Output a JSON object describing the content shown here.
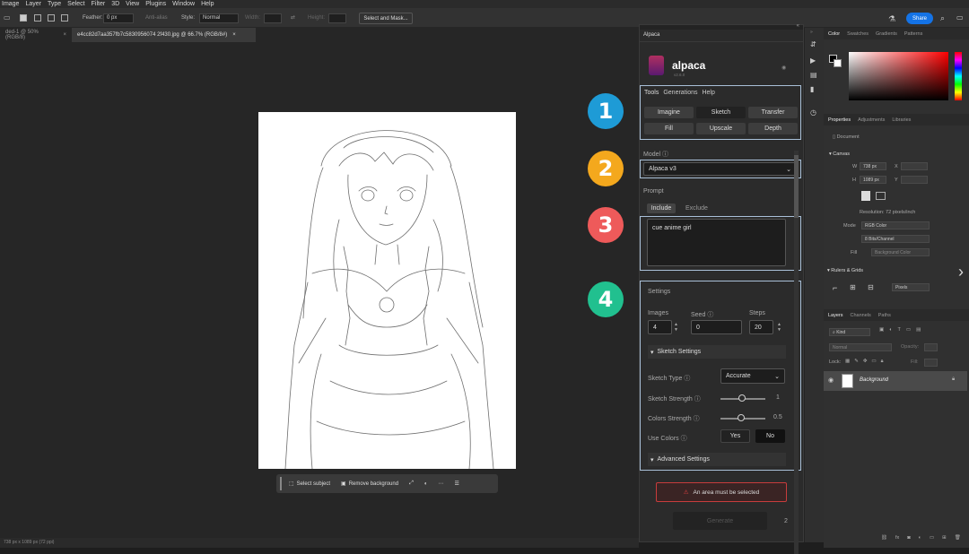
{
  "menu": [
    "Image",
    "Layer",
    "Type",
    "Select",
    "Filter",
    "3D",
    "View",
    "Plugins",
    "Window",
    "Help"
  ],
  "options": {
    "feather_label": "Feather:",
    "feather_value": "0 px",
    "anti_alias": "Anti-alias",
    "style_label": "Style:",
    "style_value": "Normal",
    "width_label": "Width:",
    "height_label": "Height:",
    "select_mask": "Select and Mask...",
    "share": "Share"
  },
  "tabs": [
    "ded-1 @ 50% (RGB/8)",
    "e4cc82d7aa357fb7c5830956074 2f430.jpg @ 66.7% (RGB/8#)"
  ],
  "context_bar": {
    "select_subject": "Select subject",
    "remove_background": "Remove background"
  },
  "status": "738 px x 1089 px (72 ppi)",
  "alpaca": {
    "panel_tab": "Alpaca",
    "title": "alpaca",
    "version": "v2.6.0",
    "menu": [
      "Tools",
      "Generations",
      "Help"
    ],
    "tools": [
      "Imagine",
      "Sketch",
      "Transfer",
      "Fill",
      "Upscale",
      "Depth"
    ],
    "model_label": "Model",
    "model_value": "Alpaca v3",
    "prompt_label": "Prompt",
    "include": "Include",
    "exclude": "Exclude",
    "prompt_text": "cue anime girl",
    "settings_label": "Settings",
    "images_label": "Images",
    "images_value": "4",
    "seed_label": "Seed",
    "seed_value": "0",
    "steps_label": "Steps",
    "steps_value": "20",
    "sketch_settings": "Sketch Settings",
    "sketch_type_label": "Sketch Type",
    "sketch_type_value": "Accurate",
    "sketch_strength_label": "Sketch Strength",
    "sketch_strength_value": "1",
    "colors_strength_label": "Colors Strength",
    "colors_strength_value": "0.5",
    "use_colors_label": "Use Colors",
    "yes": "Yes",
    "no": "No",
    "advanced_settings": "Advanced Settings",
    "error": "An area must be selected",
    "generate": "Generate",
    "count": "2"
  },
  "badges": [
    {
      "num": "1",
      "color": "#1e9bd6"
    },
    {
      "num": "2",
      "color": "#f4a81d"
    },
    {
      "num": "3",
      "color": "#ee5a5a"
    },
    {
      "num": "4",
      "color": "#21c08f"
    }
  ],
  "color_panel": {
    "tabs": [
      "Color",
      "Swatches",
      "Gradients",
      "Patterns"
    ]
  },
  "properties": {
    "tabs": [
      "Properties",
      "Adjustments",
      "Libraries"
    ],
    "document": "Document",
    "canvas": "Canvas",
    "w_label": "W",
    "w_value": "738 px",
    "h_label": "H",
    "h_value": "1089 px",
    "x_label": "X",
    "y_label": "Y",
    "resolution": "Resolution: 72 pixels/inch",
    "mode_label": "Mode",
    "mode_value": "RGB Color",
    "bits_value": "8 Bits/Channel",
    "fill_label": "Fill",
    "fill_value": "Background Color",
    "rulers": "Rulers & Grids",
    "pixels": "Pixels"
  },
  "layers": {
    "tabs": [
      "Layers",
      "Channels",
      "Paths"
    ],
    "kind": "Kind",
    "blend": "Normal",
    "opacity_label": "Opacity:",
    "lock_label": "Lock:",
    "fill_label": "Fill:",
    "layer_name": "Background"
  }
}
